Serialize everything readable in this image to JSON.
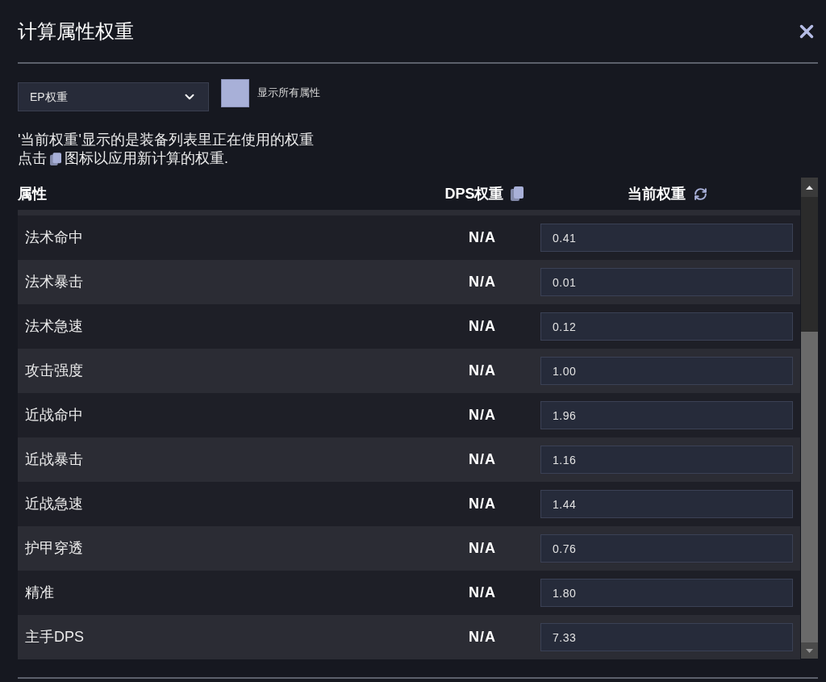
{
  "dialog": {
    "title": "计算属性权重"
  },
  "weight_select": {
    "value": "EP权重"
  },
  "show_all_checkbox": {
    "label": "显示所有属性",
    "checked": false
  },
  "info": {
    "line_1": "'当前权重'显示的是装备列表里正在使用的权重",
    "line_2_before_icon": "点击",
    "line_2_after_icon": "图标以应用新计算的权重."
  },
  "table": {
    "columns": [
      {
        "label": "属性"
      },
      {
        "label": "DPS权重"
      },
      {
        "label": "当前权重"
      }
    ],
    "rows": [
      {
        "stat": "法术命中",
        "dps_weight": "N/A",
        "current_weight": "0.41"
      },
      {
        "stat": "法术暴击",
        "dps_weight": "N/A",
        "current_weight": "0.01"
      },
      {
        "stat": "法术急速",
        "dps_weight": "N/A",
        "current_weight": "0.12"
      },
      {
        "stat": "攻击强度",
        "dps_weight": "N/A",
        "current_weight": "1.00"
      },
      {
        "stat": "近战命中",
        "dps_weight": "N/A",
        "current_weight": "1.96"
      },
      {
        "stat": "近战暴击",
        "dps_weight": "N/A",
        "current_weight": "1.16"
      },
      {
        "stat": "近战急速",
        "dps_weight": "N/A",
        "current_weight": "1.44"
      },
      {
        "stat": "护甲穿透",
        "dps_weight": "N/A",
        "current_weight": "0.76"
      },
      {
        "stat": "精准",
        "dps_weight": "N/A",
        "current_weight": "1.80"
      },
      {
        "stat": "主手DPS",
        "dps_weight": "N/A",
        "current_weight": "7.33"
      }
    ]
  }
}
